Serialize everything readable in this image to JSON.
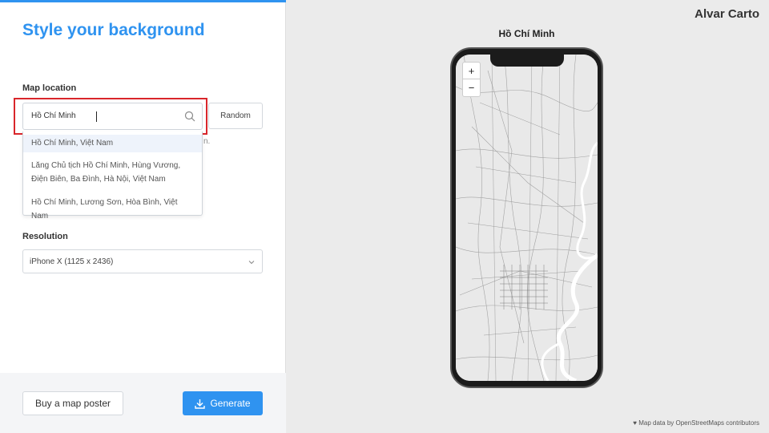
{
  "panel": {
    "title": "Style your background",
    "map_location_label": "Map location",
    "search_value": "Hồ Chí Minh",
    "random_label": "Random",
    "helper_tail": "n.",
    "suggestions": [
      "Hồ Chí Minh, Việt Nam",
      "Lăng Chủ tịch Hồ Chí Minh, Hùng Vương, Điện Biên, Ba Đình, Hà Nội, Việt Nam",
      "Hồ Chí Minh, Lương Sơn, Hòa Bình, Việt Nam"
    ],
    "resolution_label": "Resolution",
    "resolution_value": "iPhone X (1125 x 2436)",
    "buy_label": "Buy a map poster",
    "generate_label": "Generate"
  },
  "preview": {
    "brand": "Alvar Carto",
    "map_title": "Hồ Chí Minh",
    "zoom_in": "+",
    "zoom_out": "−",
    "attribution": "Map data by OpenStreetMaps contributors"
  },
  "colors": {
    "accent": "#2f93f0",
    "highlight": "#d9262b",
    "river": "#ffffff",
    "roads": "#9a9a9a"
  }
}
